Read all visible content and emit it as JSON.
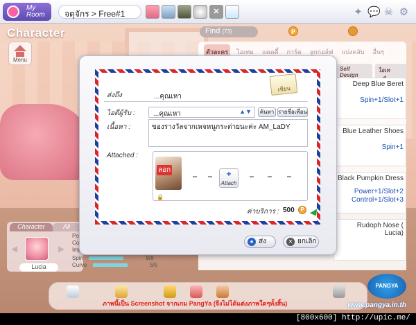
{
  "topbar": {
    "logo_label": "My Room",
    "room_name": "จตุจักร > Free#1"
  },
  "left": {
    "title": "Character",
    "menu_label": "Menu",
    "tab_character": "Character",
    "tab_all": "All",
    "char_name": "Lucia",
    "stats_labels": [
      "Pow",
      "Con",
      "Imp"
    ],
    "spin_label": "Spin",
    "spin_value": "8/8",
    "spin_fill": 1.0,
    "curve_label": "Curve",
    "curve_value": "5/5",
    "curve_fill": 1.0
  },
  "shop": {
    "find_label": "Find",
    "find_count": "(73)",
    "coin_label": "P",
    "tabs": [
      "ตัวละคร",
      "ไอเทม",
      "แคดดี้",
      "การ์ด",
      "ลูกกอล์ฟ",
      "แบ่งคลับ",
      "อื่นๆ"
    ],
    "subtabs": [
      "Self Design",
      "ไอเทมอื่นๆ"
    ],
    "items": [
      {
        "name": "Deep Blue Beret",
        "stats": [
          "Spin+1/Slot+1"
        ]
      },
      {
        "name": "Blue Leather Shoes",
        "stats": [
          "Spin+1"
        ]
      },
      {
        "name": "Black Pumpkin Dress",
        "stats": [
          "Power+1/Slot+2",
          "Control+1/Slot+3"
        ]
      },
      {
        "name": "Rudoph Nose ( Lucia)",
        "stats": []
      }
    ]
  },
  "dialog": {
    "from_label": "ส่งถึง",
    "from_value": "...คุณเหา",
    "paper_label": "เขียน",
    "to_label": "ไอดีผู้รับ :",
    "to_value": "...คุณเหา",
    "search_btn": "ค้นหา",
    "friends_btn": "รายชื่อเพื่อน",
    "content_label": "เนื้อหา :",
    "message": "ของรางวัลจากเพจหนูกระต่ายนะค่ะ AM_LaDY",
    "attached_label": "Attached :",
    "delete_label": "ลอก",
    "attach_btn": "Attach",
    "fee_label": "ค่าบริการ :",
    "fee_value": "500",
    "send_btn": "ส่ง",
    "cancel_btn": "ยกเลิก"
  },
  "bottom": {
    "notice": "ภาพนี้เป็น Screenshot จากเกม PangYa (จึงไม่ได้แต่งภาพใดๆทั้งสิ้น)",
    "site": "www.pangya.in.th",
    "logo": "PANGYA"
  },
  "footer": {
    "text": "[800x600] http://upic.me/"
  }
}
